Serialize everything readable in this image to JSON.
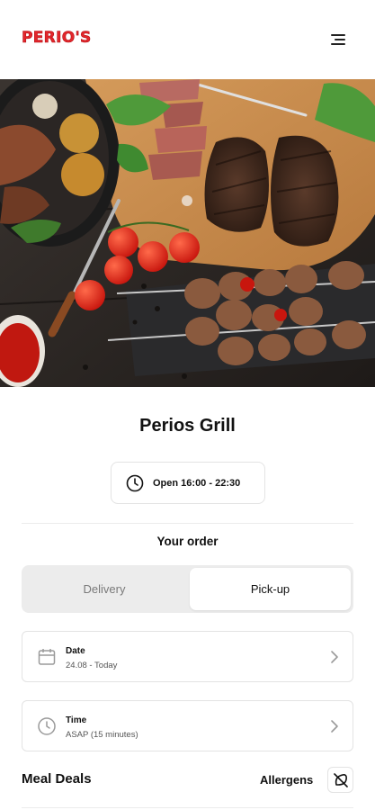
{
  "header": {
    "logo_text": "PERIO'S",
    "menu_icon": "hamburger-menu-icon"
  },
  "hero": {
    "image": "grilled-steak-and-skewers-photo"
  },
  "restaurant": {
    "name": "Perios Grill",
    "hours": "Open 16:00 - 22:30",
    "hours_icon": "clock-icon"
  },
  "order": {
    "title": "Your order",
    "modes": [
      "Delivery",
      "Pick-up"
    ],
    "selected_mode": "Pick-up",
    "date": {
      "label": "Date",
      "value": "24.08 - Today",
      "icon": "calendar-icon"
    },
    "time": {
      "label": "Time",
      "value": "ASAP (15 minutes)",
      "icon": "clock-icon"
    }
  },
  "menu": {
    "section_title": "Meal Deals",
    "allergens_label": "Allergens",
    "allergens_icon": "allergen-leaf-icon"
  },
  "colors": {
    "brand": "#e3262b",
    "text": "#111111",
    "muted": "#7a7a7a",
    "toggle_bg": "#ececec",
    "border": "#e3e3e3"
  }
}
